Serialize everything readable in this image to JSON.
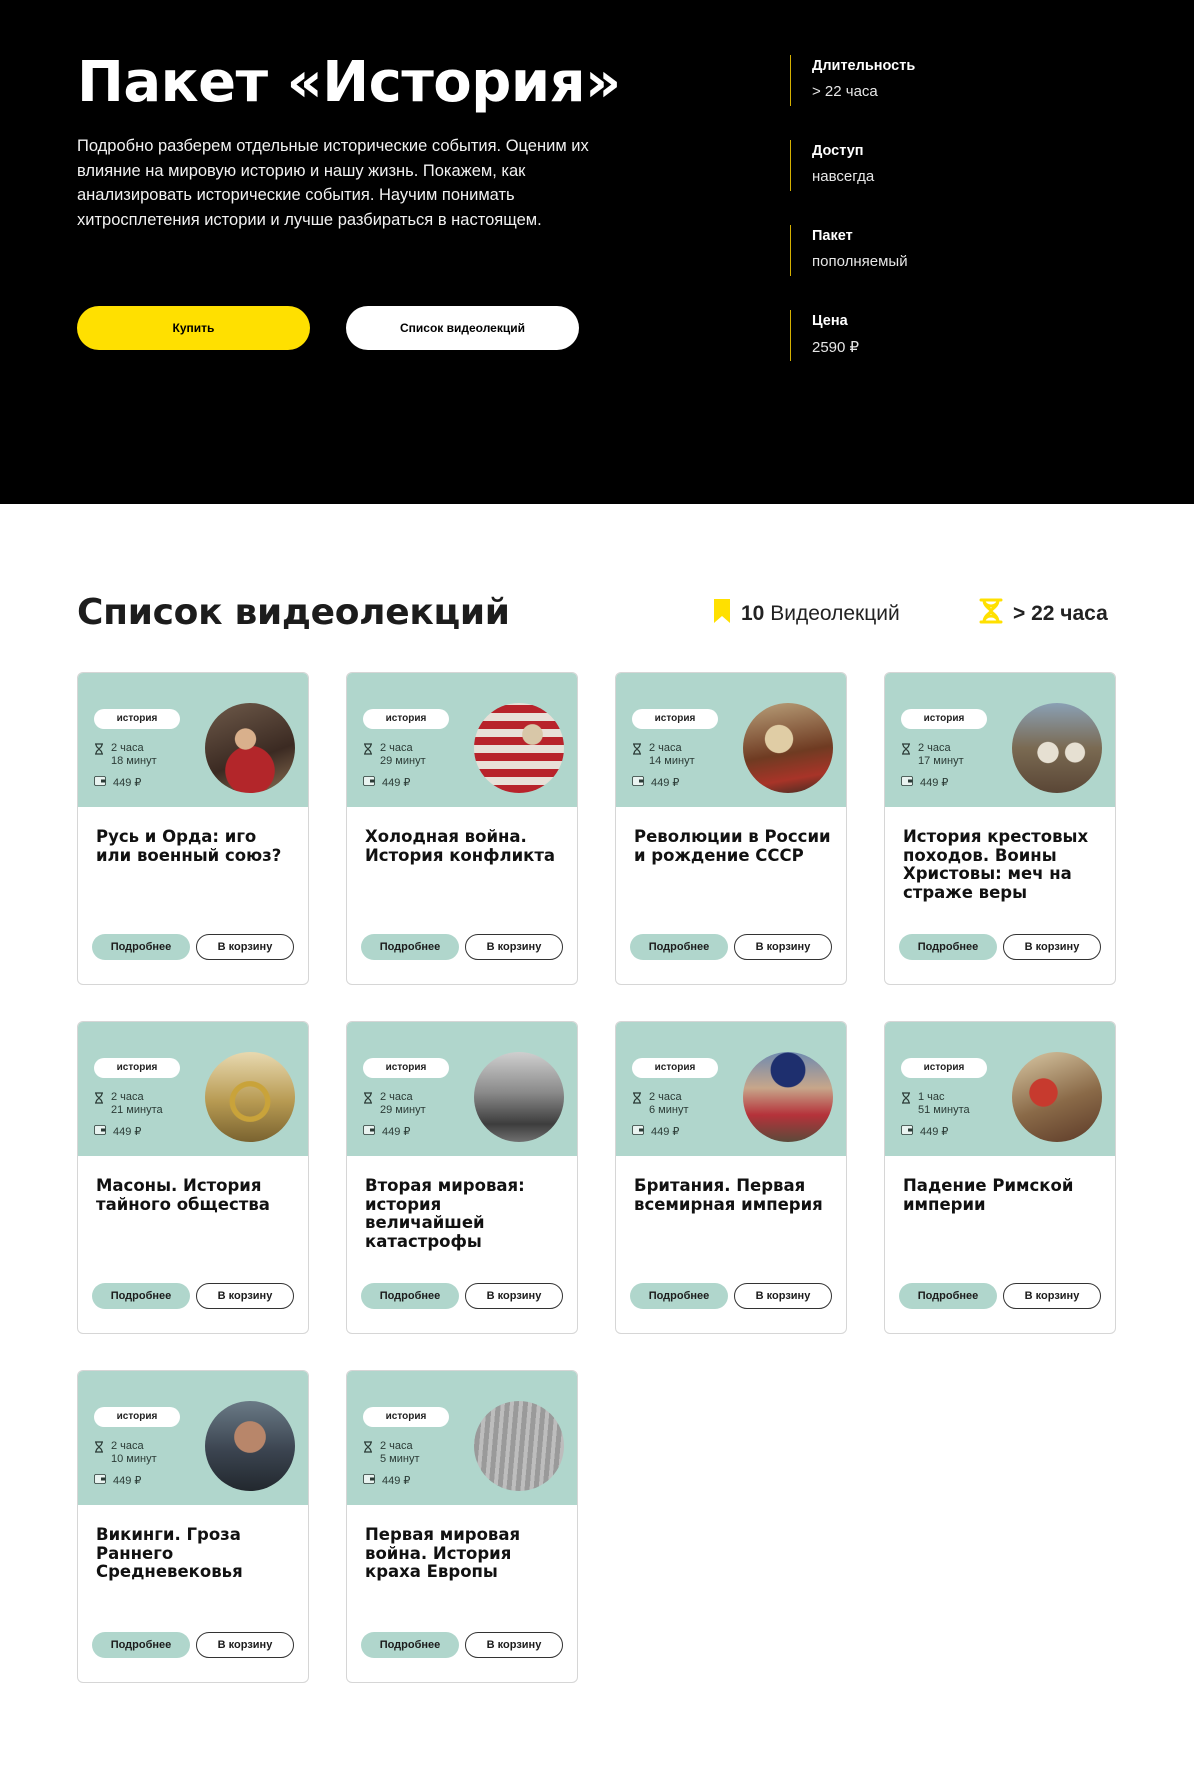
{
  "hero": {
    "title": "Пакет «История»",
    "description": "Подробно разберем отдельные исторические события. Оценим их влияние на мировую историю и нашу жизнь. Покажем, как анализировать исторические события. Научим понимать хитросплетения истории и лучше разбираться в настоящем.",
    "buy_label": "Купить",
    "list_label": "Список видеолекций",
    "facts": [
      {
        "label": "Длительность",
        "value": "> 22 часа"
      },
      {
        "label": "Доступ",
        "value": "навсегда"
      },
      {
        "label": "Пакет",
        "value": "пополняемый"
      },
      {
        "label": "Цена",
        "value": "2590 ₽"
      }
    ]
  },
  "section": {
    "title": "Список видеолекций",
    "lectures_count": "10",
    "lectures_label": "Видеолекций",
    "hours": "> 22 часа"
  },
  "cards": [
    {
      "tag": "история",
      "hours": "2 часа",
      "minutes": "18 минут",
      "price": "449 ₽",
      "title": "Русь и Орда: иго или военный союз?",
      "more": "Подробнее",
      "cart": "В корзину"
    },
    {
      "tag": "история",
      "hours": "2 часа",
      "minutes": "29 минут",
      "price": "449 ₽",
      "title": "Холодная война. История конфликта",
      "more": "Подробнее",
      "cart": "В корзину"
    },
    {
      "tag": "история",
      "hours": "2 часа",
      "minutes": "14 минут",
      "price": "449 ₽",
      "title": "Революции в России и рождение СССР",
      "more": "Подробнее",
      "cart": "В корзину"
    },
    {
      "tag": "история",
      "hours": "2 часа",
      "minutes": "17 минут",
      "price": "449 ₽",
      "title": "История крестовых походов. Воины Христовы: меч на страже веры",
      "more": "Подробнее",
      "cart": "В корзину"
    },
    {
      "tag": "история",
      "hours": "2 часа",
      "minutes": "21 минута",
      "price": "449 ₽",
      "title": "Масоны. История тайного общества",
      "more": "Подробнее",
      "cart": "В корзину"
    },
    {
      "tag": "история",
      "hours": "2 часа",
      "minutes": "29 минут",
      "price": "449 ₽",
      "title": "Вторая мировая: история величайшей катастрофы",
      "more": "Подробнее",
      "cart": "В корзину"
    },
    {
      "tag": "история",
      "hours": "2 часа",
      "minutes": "6 минут",
      "price": "449 ₽",
      "title": "Британия. Первая всемирная империя",
      "more": "Подробнее",
      "cart": "В корзину"
    },
    {
      "tag": "история",
      "hours": "1 час",
      "minutes": "51 минута",
      "price": "449 ₽",
      "title": "Падение Римской империи",
      "more": "Подробнее",
      "cart": "В корзину"
    },
    {
      "tag": "история",
      "hours": "2 часа",
      "minutes": "10 минут",
      "price": "449 ₽",
      "title": "Викинги. Гроза Раннего Средневековья",
      "more": "Подробнее",
      "cart": "В корзину"
    },
    {
      "tag": "история",
      "hours": "2 часа",
      "minutes": "5 минут",
      "price": "449 ₽",
      "title": "Первая мировая война. История краха Европы",
      "more": "Подробнее",
      "cart": "В корзину"
    }
  ],
  "icons": {
    "bookmark": "bookmark-icon",
    "hourglass": "hourglass-icon",
    "wallet": "wallet-icon"
  },
  "colors": {
    "accent_yellow": "#ffe000",
    "card_mint": "#b0d6cc",
    "hero_bg": "#000000"
  }
}
